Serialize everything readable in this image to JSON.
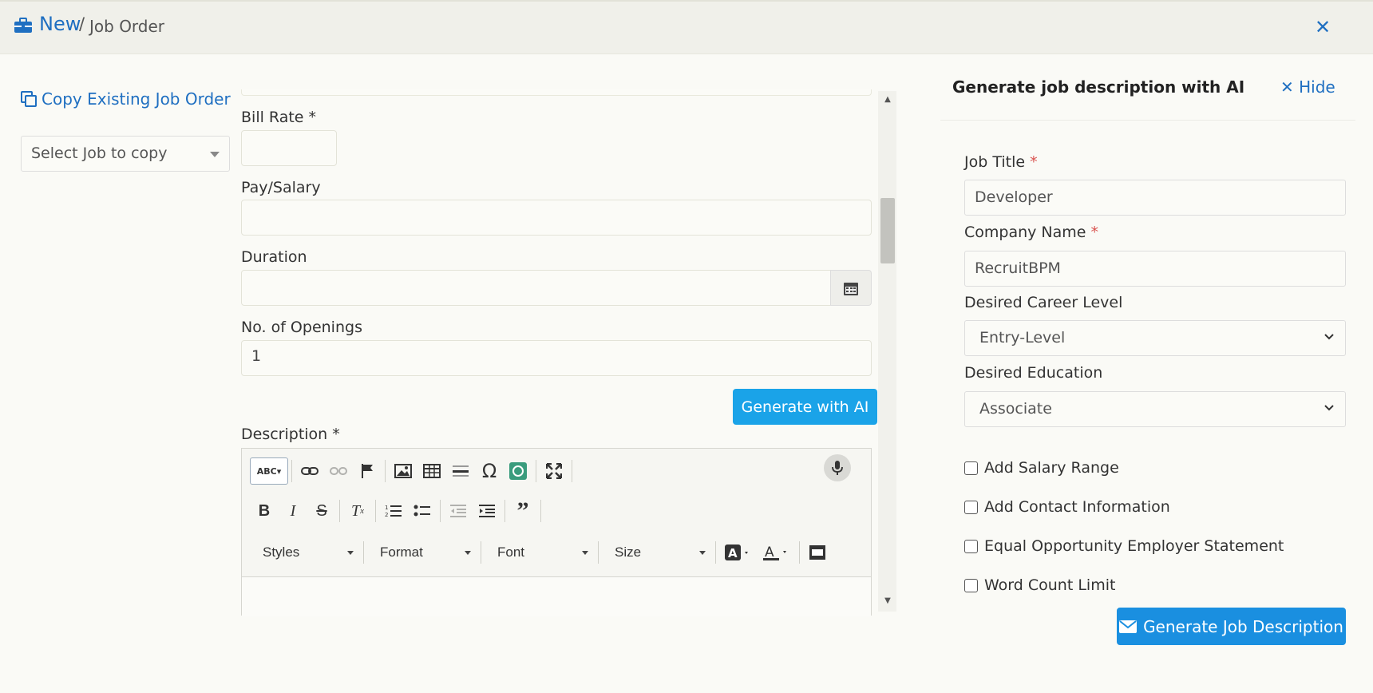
{
  "header": {
    "new_label": "New",
    "separator": "/",
    "title": "Job Order"
  },
  "left": {
    "copy_link": "Copy Existing Job Order",
    "copy_select_placeholder": "Select Job to copy"
  },
  "form": {
    "bill_rate_label": "Bill Rate *",
    "bill_rate_value": "",
    "pay_salary_label": "Pay/Salary",
    "pay_salary_value": "",
    "duration_label": "Duration",
    "duration_value": "",
    "openings_label": "No. of Openings",
    "openings_value": "1",
    "generate_ai_button": "Generate with AI",
    "description_label": "Description *"
  },
  "editor": {
    "combos": [
      "Styles",
      "Format",
      "Font",
      "Size"
    ]
  },
  "ai_panel": {
    "title": "Generate job description with AI",
    "hide_label": "Hide",
    "job_title_label": "Job Title",
    "job_title_value": "Developer",
    "company_label": "Company Name",
    "company_value": "RecruitBPM",
    "career_level_label": "Desired Career Level",
    "career_level_value": "Entry-Level",
    "education_label": "Desired Education",
    "education_value": "Associate",
    "required_mark": "*",
    "checkboxes": [
      {
        "label": "Add Salary Range",
        "checked": false
      },
      {
        "label": "Add Contact Information",
        "checked": false
      },
      {
        "label": "Equal Opportunity Employer Statement",
        "checked": false
      },
      {
        "label": "Word Count Limit",
        "checked": false
      }
    ],
    "generate_button": "Generate Job Description"
  },
  "colors": {
    "accent": "#1f6fc1",
    "ai_button": "#1aa3e8",
    "generate_button": "#1a8fe0",
    "required": "#d9534f"
  }
}
